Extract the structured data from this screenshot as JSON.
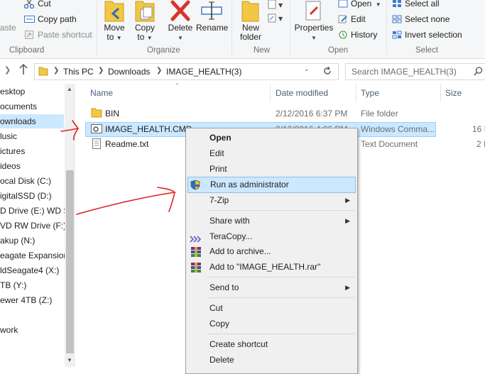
{
  "ribbon": {
    "clipboard": {
      "paste_label": "aste",
      "cut_label": "Cut",
      "copy_path_label": "Copy path",
      "paste_shortcut_label": "Paste shortcut",
      "group_label": "Clipboard"
    },
    "organize": {
      "move_to_label": "Move",
      "move_to_label2": "to",
      "copy_to_label": "Copy",
      "copy_to_label2": "to",
      "delete_label": "Delete",
      "rename_label": "Rename",
      "group_label": "Organize"
    },
    "new": {
      "new_folder_label": "New",
      "new_folder_label2": "folder",
      "group_label": "New"
    },
    "open": {
      "properties_label": "Properties",
      "open_label": "Open",
      "edit_label": "Edit",
      "history_label": "History",
      "group_label": "Open"
    },
    "select": {
      "select_all_label": "Select all",
      "select_none_label": "Select none",
      "invert_selection_label": "Invert selection",
      "group_label": "Select"
    }
  },
  "address": {
    "crumbs": [
      "This PC",
      "Downloads",
      "IMAGE_HEALTH(3)"
    ],
    "search_placeholder": "Search IMAGE_HEALTH(3)"
  },
  "nav": {
    "items": [
      {
        "label": "esktop"
      },
      {
        "label": "ocuments"
      },
      {
        "label": "ownloads"
      },
      {
        "label": "lusic"
      },
      {
        "label": "ictures"
      },
      {
        "label": "ideos"
      },
      {
        "label": "ocal Disk (C:)"
      },
      {
        "label": "igitalSSD (D:)"
      },
      {
        "label": "D Drive (E:) WD S"
      },
      {
        "label": "VD RW Drive (F:) ."
      },
      {
        "label": "akup (N:)"
      },
      {
        "label": "eagate Expansion"
      },
      {
        "label": "ldSeagate4 (X:)"
      },
      {
        "label": "TB (Y:)"
      },
      {
        "label": "ewer 4TB (Z:)"
      },
      {
        "label": "work"
      }
    ]
  },
  "columns": {
    "name": "Name",
    "date": "Date modified",
    "type": "Type",
    "size": "Size"
  },
  "files": [
    {
      "name": "BIN",
      "date": "2/12/2016 6:37 PM",
      "type": "File folder",
      "size": ""
    },
    {
      "name": "IMAGE_HEALTH.CMD",
      "date": "2/10/2016 4:06 PM",
      "type": "Windows Comma...",
      "size": "16 I"
    },
    {
      "name": "Readme.txt",
      "date": "",
      "type": "Text Document",
      "size": "2 I"
    }
  ],
  "context_menu": {
    "open": "Open",
    "edit": "Edit",
    "print": "Print",
    "run_as_admin": "Run as administrator",
    "sevenzip": "7-Zip",
    "share_with": "Share with",
    "teracopy": "TeraCopy...",
    "add_to_archive": "Add to archive...",
    "add_to_rar": "Add to \"IMAGE_HEALTH.rar\"",
    "send_to": "Send to",
    "cut": "Cut",
    "copy": "Copy",
    "create_shortcut": "Create shortcut",
    "delete": "Delete"
  },
  "colors": {
    "selection": "#cce8ff",
    "annotation": "#e02020",
    "folder": "#f2c744"
  }
}
